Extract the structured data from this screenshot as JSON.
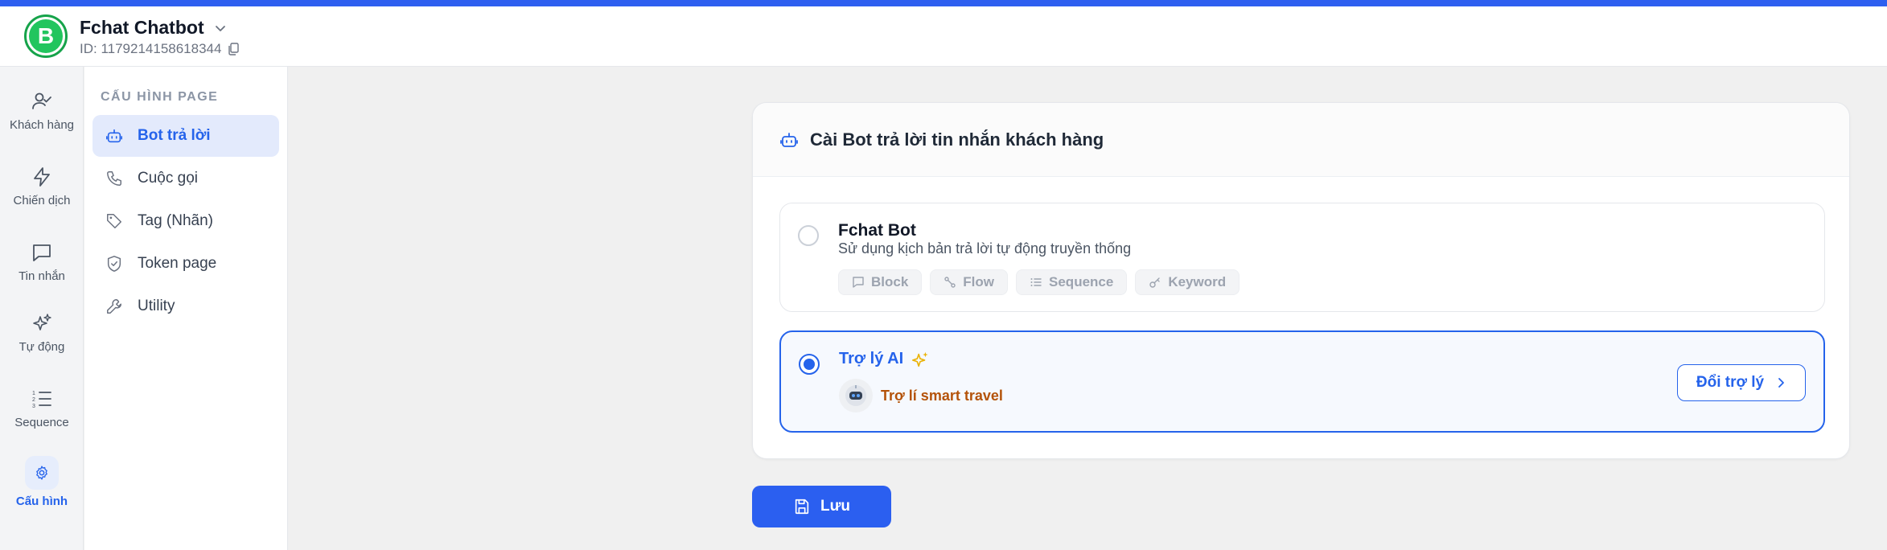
{
  "header": {
    "app_name": "Fchat Chatbot",
    "app_id": "ID: 1179214158618344",
    "logo_letter": "B"
  },
  "leftnav": {
    "items": [
      {
        "label": "Khách hàng",
        "icon": "users-check-icon"
      },
      {
        "label": "Chiến dịch",
        "icon": "lightning-icon"
      },
      {
        "label": "Tin nhắn",
        "icon": "message-icon"
      },
      {
        "label": "Tự động",
        "icon": "sparkle-icon"
      },
      {
        "label": "Sequence",
        "icon": "numbered-list-icon"
      },
      {
        "label": "Cấu hình",
        "icon": "gear-icon",
        "active": true
      }
    ]
  },
  "subnav": {
    "title": "CẤU HÌNH PAGE",
    "items": [
      {
        "label": "Bot trả lời",
        "icon": "bot-icon",
        "active": true
      },
      {
        "label": "Cuộc gọi",
        "icon": "phone-icon"
      },
      {
        "label": "Tag (Nhãn)",
        "icon": "tag-icon"
      },
      {
        "label": "Token page",
        "icon": "shield-icon"
      },
      {
        "label": "Utility",
        "icon": "wrench-icon"
      }
    ]
  },
  "card": {
    "title": "Cài Bot trả lời tin nhắn khách hàng",
    "option_fchat": {
      "title": "Fchat Bot",
      "description": "Sử dụng kịch bản trả lời tự động truyền thống",
      "chips": [
        "Block",
        "Flow",
        "Sequence",
        "Keyword"
      ],
      "selected": false
    },
    "option_ai": {
      "title": "Trợ lý AI",
      "assistant_name": "Trợ lí smart travel",
      "switch_label": "Đổi trợ lý",
      "selected": true
    }
  },
  "actions": {
    "save_label": "Lưu"
  },
  "colors": {
    "accent": "#2563eb",
    "brand_green": "#22c55e",
    "assistant_name": "#b45309"
  }
}
